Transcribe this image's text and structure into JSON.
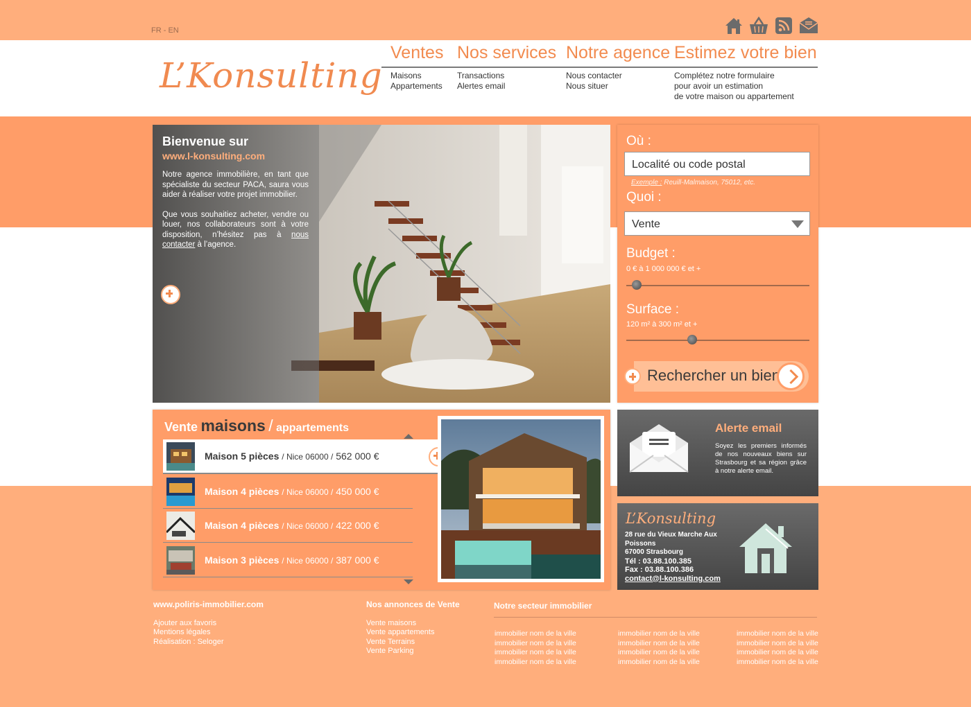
{
  "header": {
    "lang": "FR - EN",
    "logo": "L’Konsulting",
    "icons": [
      "home-icon",
      "basket-icon",
      "rss-icon",
      "mail-icon"
    ]
  },
  "nav": [
    {
      "title": "Ventes",
      "sub": [
        "Maisons",
        "Appartements"
      ]
    },
    {
      "title": "Nos services",
      "sub": [
        "Transactions",
        "Alertes email"
      ]
    },
    {
      "title": "Notre agence",
      "sub": [
        "Nous contacter",
        "Nous situer"
      ]
    },
    {
      "title": "Estimez votre bien",
      "sub": [
        "Complétez notre formulaire",
        "pour avoir un estimation",
        "de votre maison ou appartement"
      ]
    }
  ],
  "hero": {
    "title": "Bienvenue sur",
    "url": "www.l-konsulting.com",
    "p1": "Notre agence immobilière, en tant que spécialiste du secteur PACA, saura vous aider à réaliser votre projet immobilier.",
    "p2_before": "Que vous souhaitiez acheter, vendre ou louer, nos collaborateurs sont à votre disposition, n’hésitez pas à",
    "p2_link": "nous contacter",
    "p2_after": "à l’agence."
  },
  "search": {
    "where_label": "Où :",
    "where_value": "Localité ou code postal",
    "example_label": "Exemple :",
    "example_text": "Reuill-Malmaison, 75012, etc.",
    "what_label": "Quoi :",
    "what_value": "Vente",
    "budget_label": "Budget :",
    "budget_range": "0 € à 1 000 000 € et +",
    "budget_level": 0.03,
    "surface_label": "Surface :",
    "surface_range": "120 m² à 300 m² et +",
    "surface_level": 0.35,
    "button": "Rechercher un bien"
  },
  "vente": {
    "t1": "Vente",
    "t2": "maisons",
    "t3": "/",
    "t4": "appartements",
    "listings": [
      {
        "name": "Maison 5 pièces",
        "loc": "/ Nice 06000 /",
        "price": "562 000 €"
      },
      {
        "name": "Maison 4 pièces",
        "loc": "/ Nice 06000 /",
        "price": "450 000 €"
      },
      {
        "name": "Maison 4 pièces",
        "loc": "/ Nice 06000 /",
        "price": "422 000 €"
      },
      {
        "name": "Maison 3 pièces",
        "loc": "/ Nice 06000 /",
        "price": "387 000 €"
      }
    ]
  },
  "alerte": {
    "title": "Alerte email",
    "text": "Soyez les premiers informés de nos nouveaux biens sur Strasbourg et sa région grâce à notre alerte email."
  },
  "contact": {
    "logo": "L’Konsulting",
    "address1": "28 rue du Vieux Marche Aux Poissons",
    "address2": "67000 Strasbourg",
    "tel": "Tél : 03.88.100.385",
    "fax": "Fax : 03.88.100.386",
    "email": "contact@l-konsulting.com"
  },
  "footer": {
    "site": "www.poliris-immobilier.com",
    "links1": [
      "Ajouter aux favoris",
      "Mentions légales",
      "Réalisation : Seloger"
    ],
    "annonces_title": "Nos annonces de Vente",
    "links2": [
      "Vente maisons",
      "Vente appartements",
      "Vente Terrains",
      "Vente Parking"
    ],
    "secteur_title": "Notre secteur immobilier",
    "secteur_item": "immobilier nom de la ville"
  },
  "colors": {
    "accent": "#f28b4f",
    "orange_bg": "#ffae7c",
    "panel": "#ff9d68",
    "dark": "#555555"
  }
}
